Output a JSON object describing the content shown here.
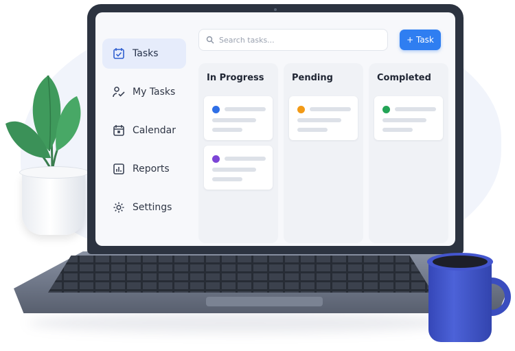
{
  "sidebar": {
    "items": [
      {
        "label": "Tasks",
        "icon": "checkbox-calendar-icon",
        "active": true
      },
      {
        "label": "My Tasks",
        "icon": "person-check-icon",
        "active": false
      },
      {
        "label": "Calendar",
        "icon": "calendar-icon",
        "active": false
      },
      {
        "label": "Reports",
        "icon": "bar-chart-icon",
        "active": false
      },
      {
        "label": "Settings",
        "icon": "gear-icon",
        "active": false
      }
    ]
  },
  "search": {
    "placeholder": "Search tasks..."
  },
  "toolbar": {
    "add_label": "+ Task"
  },
  "board": {
    "columns": [
      {
        "title": "In Progress",
        "card_dots": [
          "#2f6fe6",
          "#7c45d6"
        ]
      },
      {
        "title": "Pending",
        "card_dots": [
          "#f29a16"
        ]
      },
      {
        "title": "Completed",
        "card_dots": [
          "#23a456"
        ]
      }
    ]
  },
  "colors": {
    "accent": "#2f7ef1",
    "sidebar_active_bg": "#e6ecfb",
    "mug": "#3a4dbf",
    "leaf": "#3f9a5c"
  }
}
